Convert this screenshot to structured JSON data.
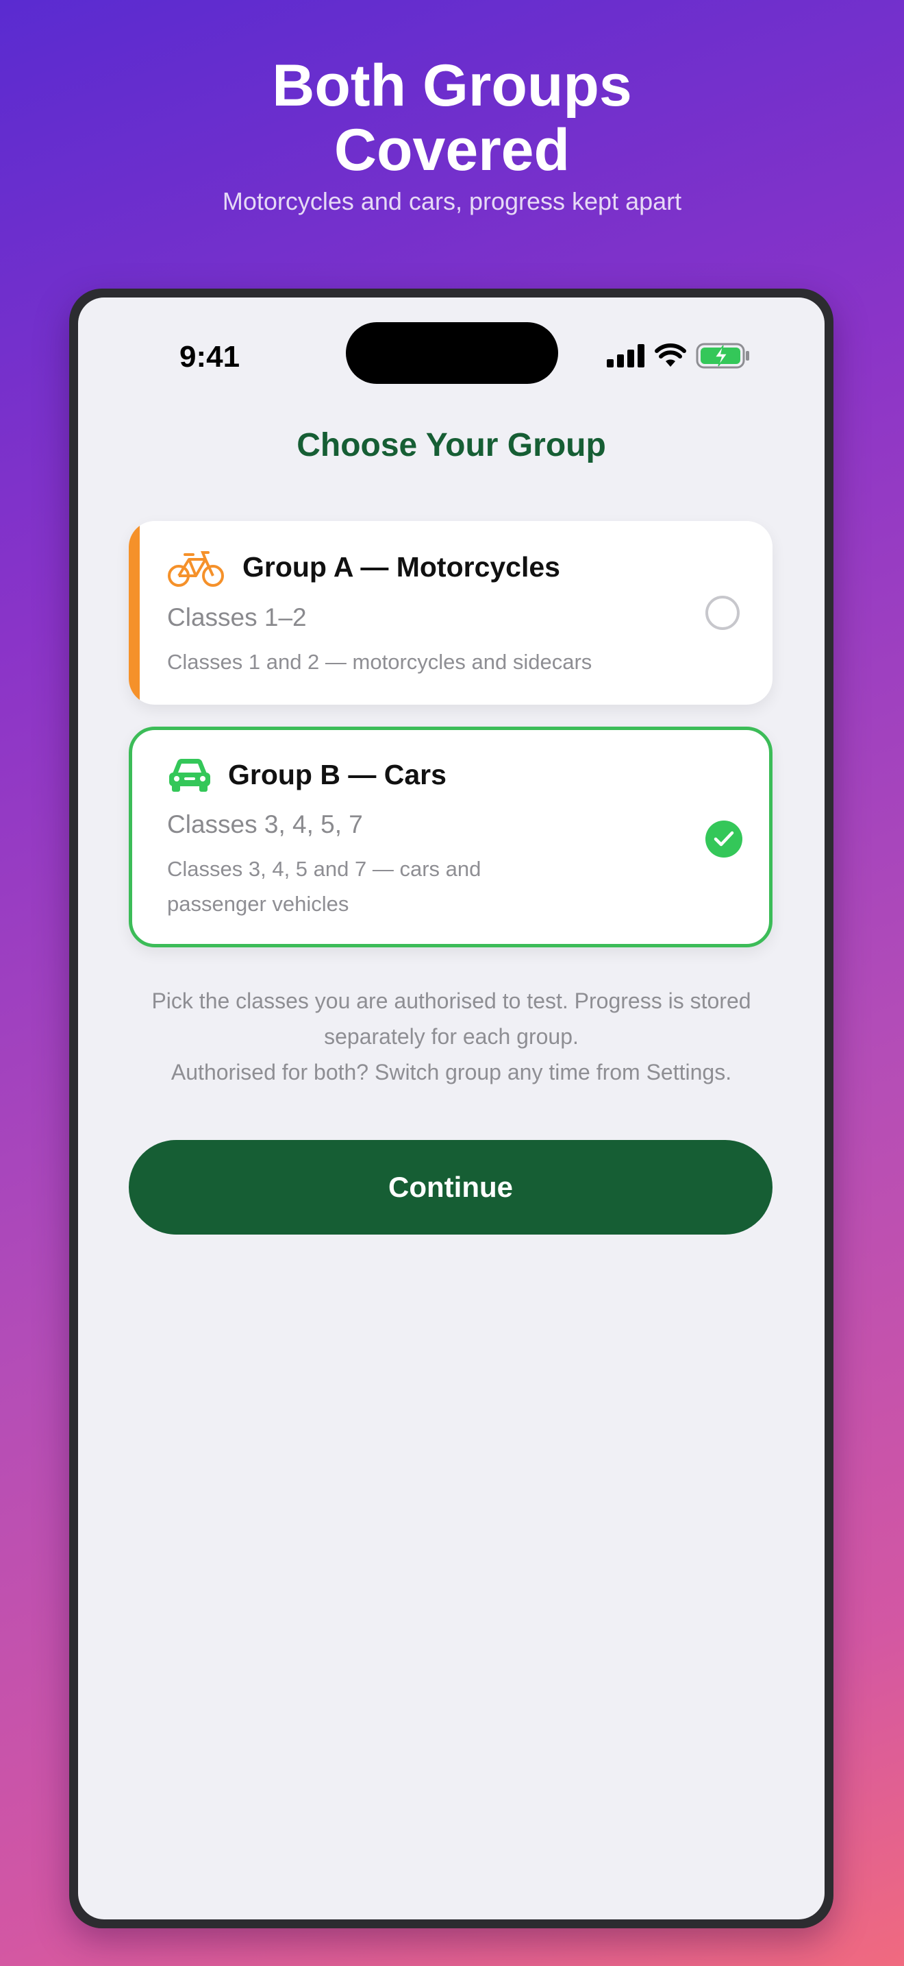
{
  "hero": {
    "title_line1": "Both Groups",
    "title_line2": "Covered",
    "subtitle": "Motorcycles and cars, progress kept apart"
  },
  "status_bar": {
    "time": "9:41",
    "icons": [
      "cellular-signal-icon",
      "wifi-icon",
      "battery-charging-icon"
    ]
  },
  "screen": {
    "title": "Choose Your Group"
  },
  "groups": [
    {
      "icon": "bicycle-icon",
      "title": "Group A — Motorcycles",
      "classes": "Classes 1–2",
      "description": "Classes 1 and 2 — motorcycles and sidecars",
      "selected": false,
      "accent_color": "#f5912a"
    },
    {
      "icon": "car-icon",
      "title": "Group B — Cars",
      "classes": "Classes 3, 4, 5, 7",
      "description_line1": "Classes 3, 4, 5 and 7 — cars and",
      "description_line2": "passenger vehicles",
      "selected": true,
      "accent_color": "#3cbc58"
    }
  ],
  "help_text": {
    "line1": "Pick the classes you are authorised to test. Progress is stored",
    "line2": "separately for each group.",
    "line3": "Authorised for both? Switch group any time from Settings."
  },
  "continue_label": "Continue",
  "colors": {
    "brand_green": "#165e34",
    "selected_green": "#34c759",
    "motorcycle_orange": "#f5912a"
  }
}
